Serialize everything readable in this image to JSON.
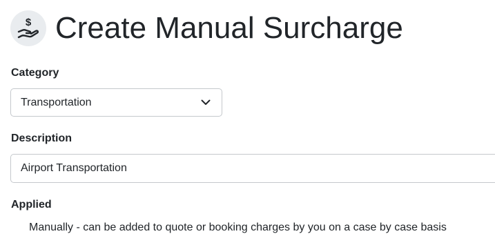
{
  "header": {
    "icon": "hand-dollar-icon",
    "title": "Create Manual Surcharge"
  },
  "form": {
    "category": {
      "label": "Category",
      "selected": "Transportation"
    },
    "description": {
      "label": "Description",
      "value": "Airport Transportation"
    },
    "applied": {
      "label": "Applied",
      "text": "Manually - can be added to quote or booking charges by you on a case by case basis"
    }
  }
}
